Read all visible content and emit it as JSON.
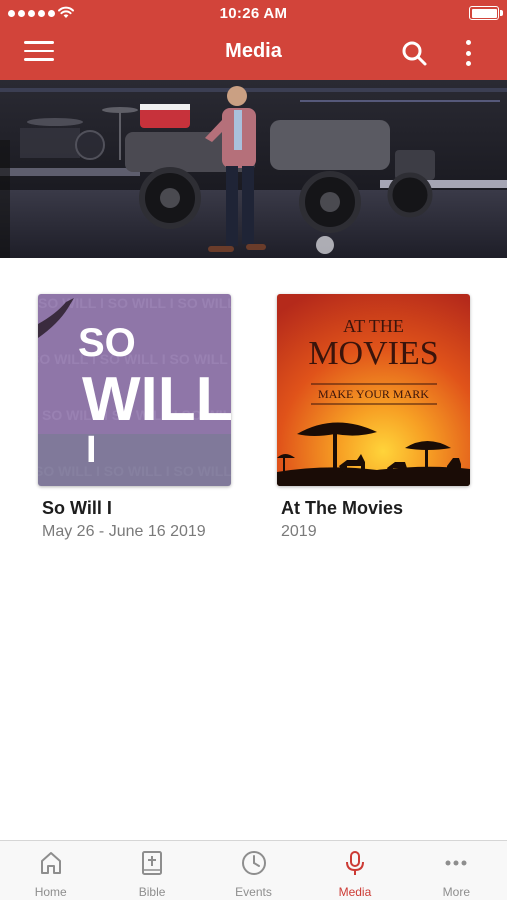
{
  "status_bar": {
    "time": "10:26 AM",
    "signal_bars": 5,
    "battery_level": 1.0
  },
  "nav": {
    "title": "Media",
    "menu_icon": "hamburger-menu-icon",
    "search_icon": "search-icon",
    "more_icon": "kebab-menu-icon"
  },
  "hero": {
    "description_icon": "featured-media-banner"
  },
  "media_items": [
    {
      "title": "So Will I",
      "subtitle": "May 26 - June 16 2019",
      "artwork_text": [
        "SO",
        "WILL",
        "I"
      ],
      "artwork_color": "#8f76a8"
    },
    {
      "title": "At The Movies",
      "subtitle": "2019",
      "artwork_text": [
        "AT THE",
        "MOVIES",
        "MAKE YOUR MARK"
      ],
      "artwork_color": "#e05a1c"
    }
  ],
  "tabs": [
    {
      "label": "Home",
      "icon": "home-icon",
      "active": false
    },
    {
      "label": "Bible",
      "icon": "bible-icon",
      "active": false
    },
    {
      "label": "Events",
      "icon": "clock-icon",
      "active": false
    },
    {
      "label": "Media",
      "icon": "microphone-icon",
      "active": true
    },
    {
      "label": "More",
      "icon": "more-dots-icon",
      "active": false
    }
  ],
  "colors": {
    "brand": "#d2443a",
    "active_tab": "#cc3b35",
    "inactive_tab": "#8e8e8e"
  }
}
